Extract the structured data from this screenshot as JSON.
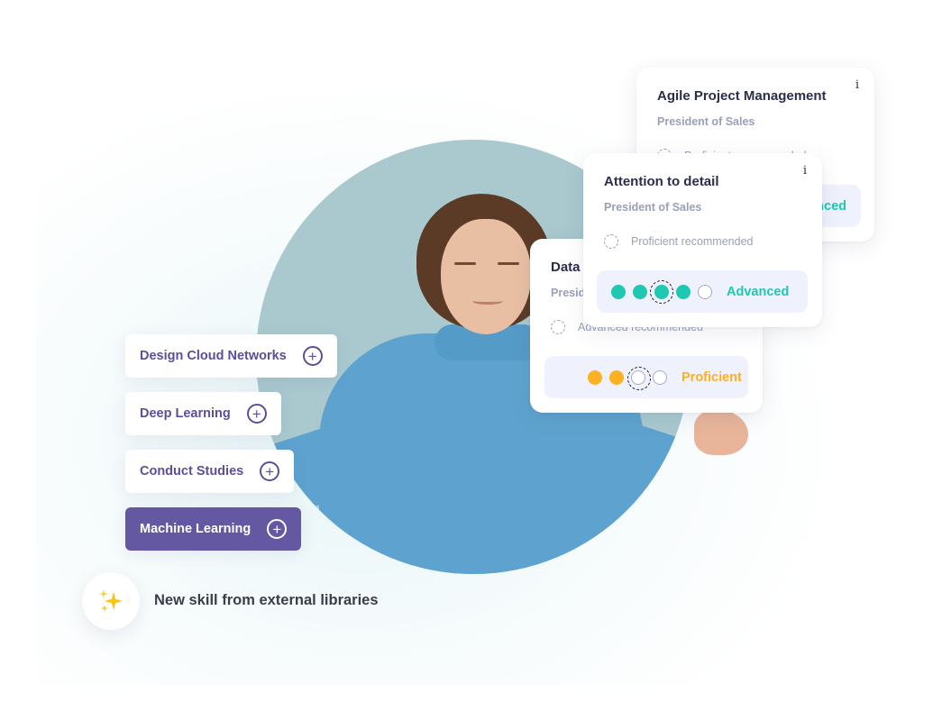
{
  "colors": {
    "accent_purple": "#6558a2",
    "advanced_teal": "#1fc8b0",
    "proficient_amber": "#fbb122",
    "title_dark": "#2b2d4a",
    "subtitle_grey": "#9aa0b8",
    "level_bg": "#eff1fd"
  },
  "skill_cards": [
    {
      "title": "Agile Project Management",
      "role": "President of Sales",
      "recommendation": "Proficient recommended",
      "level_label": "Advanced",
      "info_icon": "i"
    },
    {
      "title": "Attention to detail",
      "role": "President of Sales",
      "recommendation": "Proficient recommended",
      "level_label": "Advanced",
      "level_value": 4,
      "level_max": 5,
      "current_marker": 3,
      "info_icon": "i"
    },
    {
      "title": "Data",
      "role": "President of Sales",
      "recommendation": "Advanced recommended",
      "level_label": "Proficient",
      "level_value": 2,
      "level_max": 4,
      "current_marker": 3
    }
  ],
  "skill_chips": [
    {
      "label": "Design Cloud Networks",
      "icon": "plus-circle-icon",
      "active": false
    },
    {
      "label": "Deep Learning",
      "icon": "plus-circle-icon",
      "active": false
    },
    {
      "label": "Conduct Studies",
      "icon": "plus-circle-icon",
      "active": false
    },
    {
      "label": "Machine Learning",
      "icon": "plus-circle-icon",
      "active": true
    }
  ],
  "footer": {
    "icon": "sparkles-icon",
    "text": "New skill from external libraries"
  },
  "hero": {
    "image": "woman-meditating-photo"
  }
}
